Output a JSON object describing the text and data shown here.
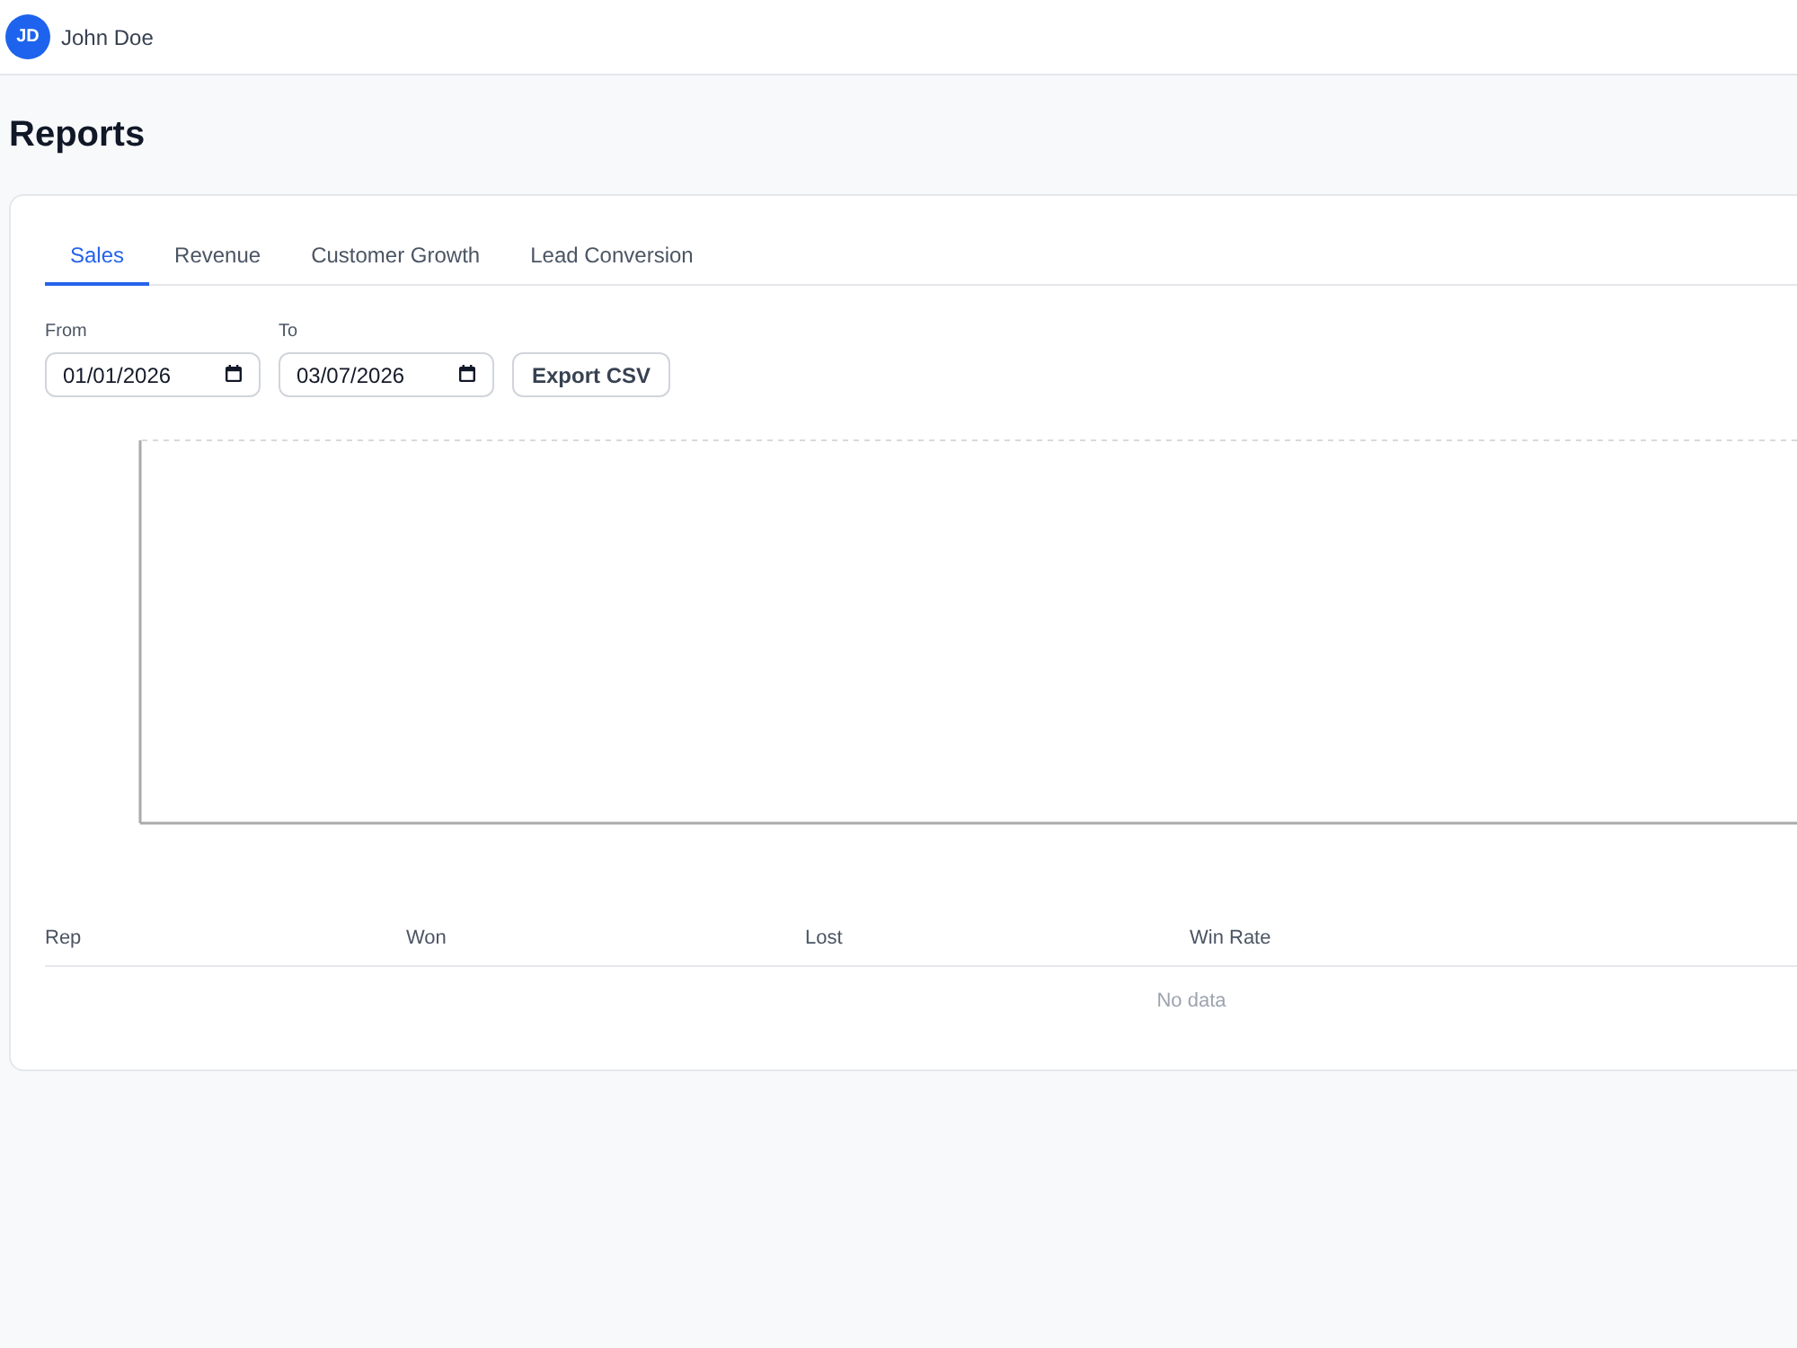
{
  "user": {
    "initials": "JD",
    "name": "John Doe"
  },
  "page": {
    "title": "Reports"
  },
  "tabs": [
    {
      "label": "Sales",
      "selected": true
    },
    {
      "label": "Revenue",
      "selected": false
    },
    {
      "label": "Customer Growth",
      "selected": false
    },
    {
      "label": "Lead Conversion",
      "selected": false
    }
  ],
  "filters": {
    "from": {
      "label": "From",
      "value": "01/01/2026"
    },
    "to": {
      "label": "To",
      "value": "03/07/2026"
    },
    "export_button": "Export CSV"
  },
  "table": {
    "columns": [
      "Rep",
      "Won",
      "Lost",
      "Win Rate"
    ],
    "empty_message": "No data"
  }
}
